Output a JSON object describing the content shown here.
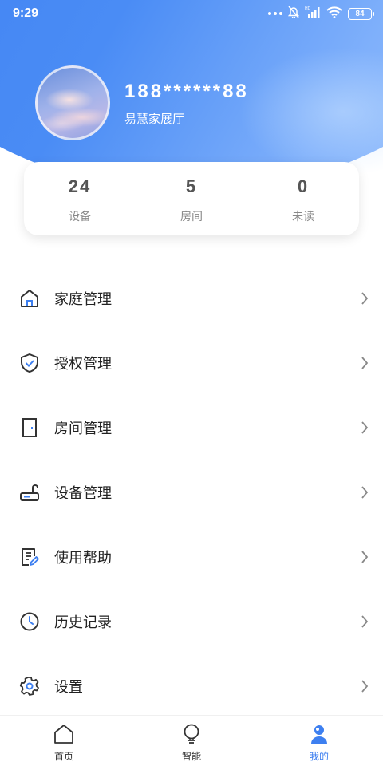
{
  "status_bar": {
    "time": "9:29",
    "battery": "84"
  },
  "profile": {
    "phone": "188******88",
    "home_name": "易慧家展厅"
  },
  "stats": [
    {
      "value": "24",
      "label": "设备"
    },
    {
      "value": "5",
      "label": "房间"
    },
    {
      "value": "0",
      "label": "未读"
    }
  ],
  "menu": [
    {
      "label": "家庭管理",
      "icon": "home-icon"
    },
    {
      "label": "授权管理",
      "icon": "shield-check-icon"
    },
    {
      "label": "房间管理",
      "icon": "door-icon"
    },
    {
      "label": "设备管理",
      "icon": "router-icon"
    },
    {
      "label": "使用帮助",
      "icon": "document-edit-icon"
    },
    {
      "label": "历史记录",
      "icon": "clock-icon"
    },
    {
      "label": "设置",
      "icon": "gear-icon"
    }
  ],
  "bottom_nav": [
    {
      "label": "首页",
      "icon": "home-icon"
    },
    {
      "label": "智能",
      "icon": "bulb-icon"
    },
    {
      "label": "我的",
      "icon": "profile-icon",
      "active": true
    }
  ],
  "colors": {
    "accent": "#3d7ff0",
    "header_gradient_start": "#3d7ff0",
    "header_gradient_end": "#9cc3fd",
    "icon_stroke": "#333333",
    "chevron": "#888888"
  }
}
